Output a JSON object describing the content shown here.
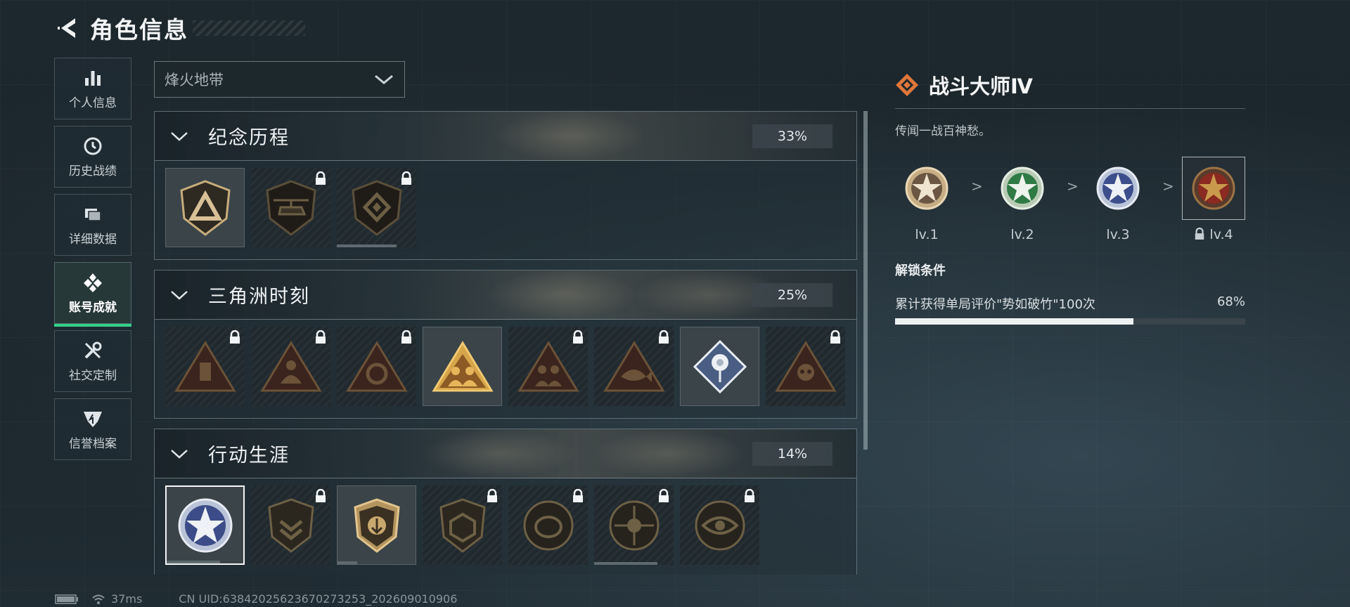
{
  "header": {
    "title": "角色信息"
  },
  "sidebar": {
    "items": [
      {
        "label": "个人信息",
        "icon": "bar-chart-icon",
        "active": false
      },
      {
        "label": "历史战绩",
        "icon": "clock-icon",
        "active": false
      },
      {
        "label": "详细数据",
        "icon": "folders-icon",
        "active": false
      },
      {
        "label": "账号成就",
        "icon": "achievement-icon",
        "active": true
      },
      {
        "label": "社交定制",
        "icon": "tools-icon",
        "active": false
      },
      {
        "label": "信誉档案",
        "icon": "emblem-icon",
        "active": false
      }
    ]
  },
  "mode_select": {
    "value": "烽火地带"
  },
  "sections": [
    {
      "title": "纪念历程",
      "percent": "33%",
      "badges": [
        {
          "icon": "triangle-shield-badge",
          "locked": false
        },
        {
          "icon": "helicopter-shield-badge",
          "locked": true
        },
        {
          "icon": "diamond-shield-badge",
          "locked": true,
          "progress": 0.75
        }
      ]
    },
    {
      "title": "三角洲时刻",
      "percent": "25%",
      "badges": [
        {
          "icon": "usb-triangle-badge",
          "locked": true
        },
        {
          "icon": "figure-triangle-badge",
          "locked": true
        },
        {
          "icon": "gear-triangle-badge",
          "locked": true
        },
        {
          "icon": "team-triangle-badge",
          "locked": false
        },
        {
          "icon": "soldiers-triangle-badge",
          "locked": true
        },
        {
          "icon": "fish-triangle-badge",
          "locked": true
        },
        {
          "icon": "rose-diamond-badge",
          "locked": false
        },
        {
          "icon": "skull-triangle-badge",
          "locked": true
        }
      ]
    },
    {
      "title": "行动生涯",
      "percent": "14%",
      "badges": [
        {
          "icon": "star-medal-badge",
          "locked": false,
          "selected": true,
          "progress": 0.7
        },
        {
          "icon": "chevron-shield-badge",
          "locked": true
        },
        {
          "icon": "arrow-shield-badge",
          "locked": false,
          "progress": 0.25
        },
        {
          "icon": "dice-shield-badge",
          "locked": true
        },
        {
          "icon": "shell-medal-badge",
          "locked": true
        },
        {
          "icon": "crosshair-medal-badge",
          "locked": true,
          "progress": 0.8
        },
        {
          "icon": "eye-medal-badge",
          "locked": true
        }
      ]
    }
  ],
  "detail": {
    "title": "战斗大师Ⅳ",
    "description": "传闻一战百神愁。",
    "levels": [
      {
        "label": "lv.1",
        "color": "#b39a78",
        "locked": false
      },
      {
        "label": "lv.2",
        "color": "#2f7a45",
        "locked": false
      },
      {
        "label": "lv.3",
        "color": "#3d4e8c",
        "locked": false
      },
      {
        "label": "lv.4",
        "color": "#8a2a20",
        "locked": true
      }
    ],
    "arrow": ">",
    "unlock_title": "解锁条件",
    "condition": {
      "text": "累计获得单局评价\"势如破竹\"100次",
      "percent": "68%",
      "progress": 0.68
    }
  },
  "footer": {
    "ping": "37ms",
    "uid": "CN UID:638420256236702732​53_202609010906"
  },
  "colors": {
    "active_accent": "#33d08a",
    "brand_orange": "#e0773a"
  }
}
